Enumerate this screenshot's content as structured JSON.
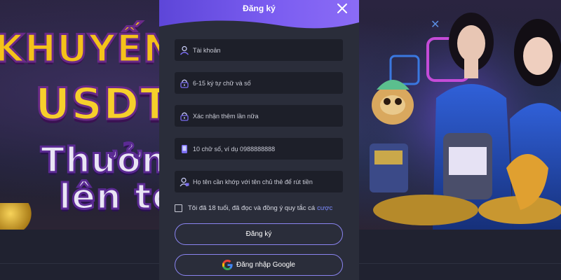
{
  "background": {
    "promo_lines": [
      "KHUYẾN",
      "USDT",
      "Thưởn",
      "lên tó"
    ]
  },
  "modal": {
    "title": "Đăng ký",
    "close_icon": "close-icon",
    "fields": [
      {
        "name": "username",
        "icon": "user-icon",
        "placeholder": "Tài khoản"
      },
      {
        "name": "password",
        "icon": "lock-icon",
        "placeholder": "6-15 ký tự chữ và số"
      },
      {
        "name": "confirm-password",
        "icon": "lock-icon",
        "placeholder": "Xác nhận thêm lần nữa"
      },
      {
        "name": "phone",
        "icon": "phone-icon",
        "placeholder": "10 chữ số, ví dụ 0988888888"
      },
      {
        "name": "fullname",
        "icon": "user-id-icon",
        "placeholder": "Họ tên cần khớp với tên chủ thẻ để rút tiền"
      }
    ],
    "agree": {
      "text": "Tôi đã 18 tuổi, đã đọc và đồng ý quy tắc cá",
      "link": "cược",
      "checked": false
    },
    "register_button": "Đăng ký",
    "google_button": "Đăng nhập Google"
  },
  "colors": {
    "header_start": "#5d46d8",
    "header_end": "#8b6cf6",
    "modal_bg": "#2a2d3a",
    "field_bg": "#1d1f29",
    "button_border": "#8a84f0",
    "link": "#7d8bff"
  }
}
